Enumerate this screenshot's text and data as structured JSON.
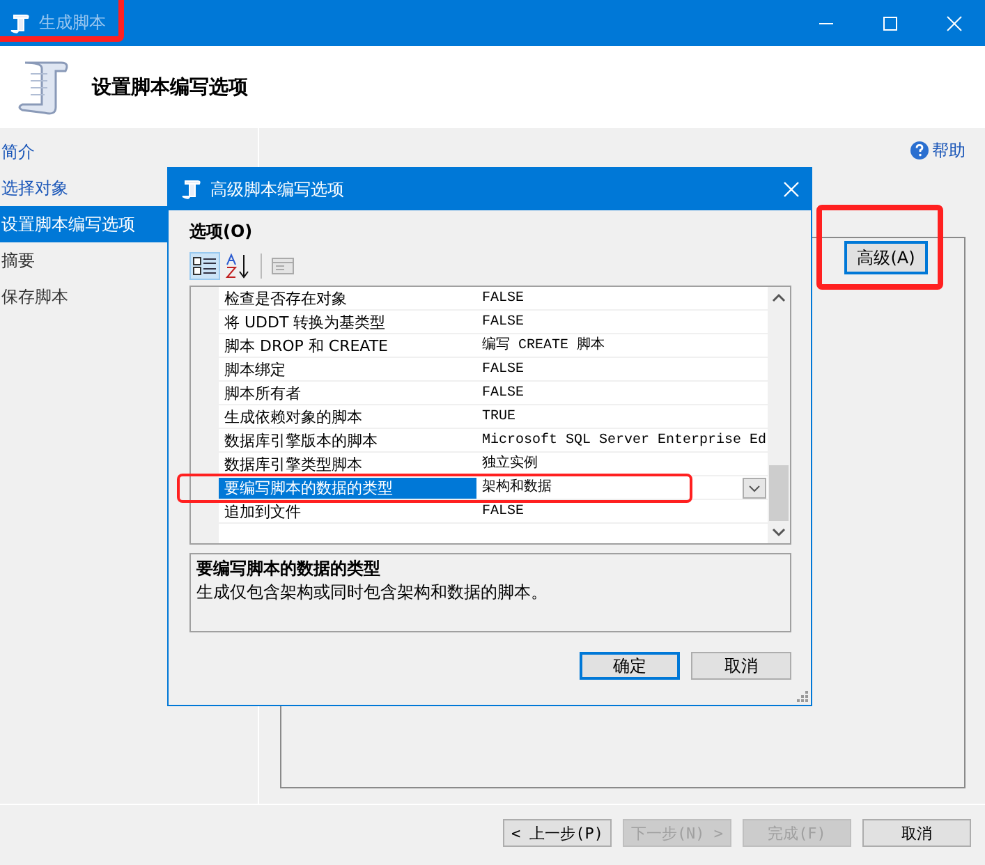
{
  "window": {
    "title": "生成脚本"
  },
  "header": {
    "title": "设置脚本编写选项"
  },
  "sidebar": {
    "items": [
      {
        "label": "简介",
        "selected": false,
        "enabled": true
      },
      {
        "label": "选择对象",
        "selected": false,
        "enabled": true
      },
      {
        "label": "设置脚本编写选项",
        "selected": true,
        "enabled": true
      },
      {
        "label": "摘要",
        "selected": false,
        "enabled": false
      },
      {
        "label": "保存脚本",
        "selected": false,
        "enabled": false
      }
    ]
  },
  "help_link": "帮助",
  "advanced_button": "高级(A)",
  "footer_buttons": [
    {
      "label": "< 上一步(P)",
      "disabled": false
    },
    {
      "label": "下一步(N) >",
      "disabled": true
    },
    {
      "label": "完成(F)",
      "disabled": true
    },
    {
      "label": "取消",
      "disabled": false
    }
  ],
  "dialog": {
    "title": "高级脚本编写选项",
    "options_label": "选项(O)",
    "properties": [
      {
        "name": "检查是否存在对象",
        "value": "FALSE",
        "selected": false,
        "dropdown": false
      },
      {
        "name": "将 UDDT 转换为基类型",
        "value": "FALSE",
        "selected": false,
        "dropdown": false
      },
      {
        "name": "脚本 DROP 和 CREATE",
        "value": "编写 CREATE 脚本",
        "selected": false,
        "dropdown": false
      },
      {
        "name": "脚本绑定",
        "value": "FALSE",
        "selected": false,
        "dropdown": false
      },
      {
        "name": "脚本所有者",
        "value": "FALSE",
        "selected": false,
        "dropdown": false
      },
      {
        "name": "生成依赖对象的脚本",
        "value": "TRUE",
        "selected": false,
        "dropdown": false
      },
      {
        "name": "数据库引擎版本的脚本",
        "value": "Microsoft SQL Server Enterprise Ed",
        "selected": false,
        "dropdown": false
      },
      {
        "name": "数据库引擎类型脚本",
        "value": "独立实例",
        "selected": false,
        "dropdown": false
      },
      {
        "name": "要编写脚本的数据的类型",
        "value": "架构和数据",
        "selected": true,
        "dropdown": true
      },
      {
        "name": "追加到文件",
        "value": "FALSE",
        "selected": false,
        "dropdown": false
      }
    ],
    "description": {
      "title": "要编写脚本的数据的类型",
      "text": "生成仅包含架构或同时包含架构和数据的脚本。"
    },
    "buttons": [
      {
        "label": "确定",
        "default": true
      },
      {
        "label": "取消",
        "default": false
      }
    ]
  }
}
